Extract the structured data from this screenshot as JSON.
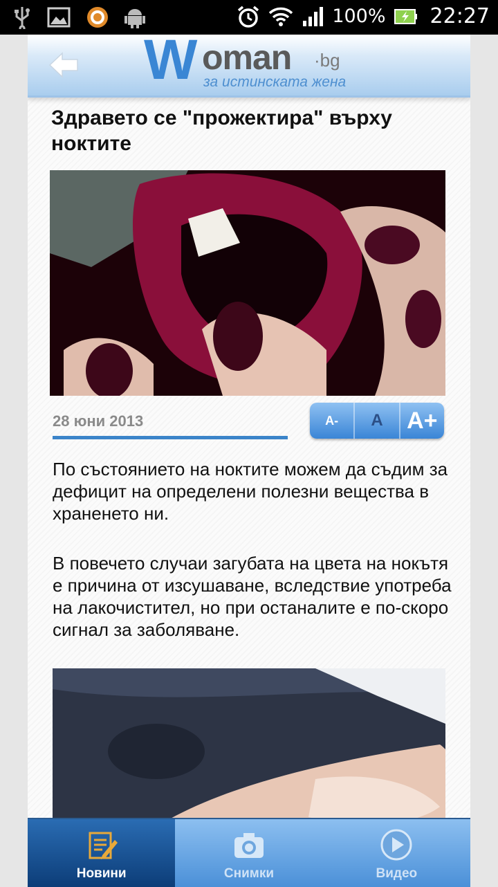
{
  "status_bar": {
    "battery_percent": "100%",
    "time": "22:27",
    "icons_left": [
      "usb-icon",
      "image-icon",
      "app-icon",
      "android-icon"
    ],
    "icons_right": [
      "alarm-icon",
      "wifi-icon",
      "signal-icon",
      "battery-icon"
    ]
  },
  "header": {
    "logo_w": "W",
    "logo_rest": "oman",
    "logo_tld": "·bg",
    "logo_tagline": "за истинската жена"
  },
  "article": {
    "title": "Здравето се \"прожектира\" върху ноктите",
    "date": "28 юни 2013",
    "paragraphs": [
      "По състоянието на ноктите можем да съдим за дефицит на определени полезни вещества в храненето ни.",
      "В повечето случаи загубата на цвета на нокътя е причина от изсушаване, вследствие употреба на лакочистител, но при останалите е по-скоро сигнал за заболяване."
    ]
  },
  "font_controls": {
    "decrease": "A-",
    "normal": "A",
    "increase": "A+"
  },
  "tabs": [
    {
      "label": "Новини",
      "icon": "news-icon",
      "active": true
    },
    {
      "label": "Снимки",
      "icon": "camera-icon",
      "active": false
    },
    {
      "label": "Видео",
      "icon": "play-icon",
      "active": false
    }
  ],
  "colors": {
    "accent": "#3b84c9",
    "tab_active": "#0c3d78"
  }
}
